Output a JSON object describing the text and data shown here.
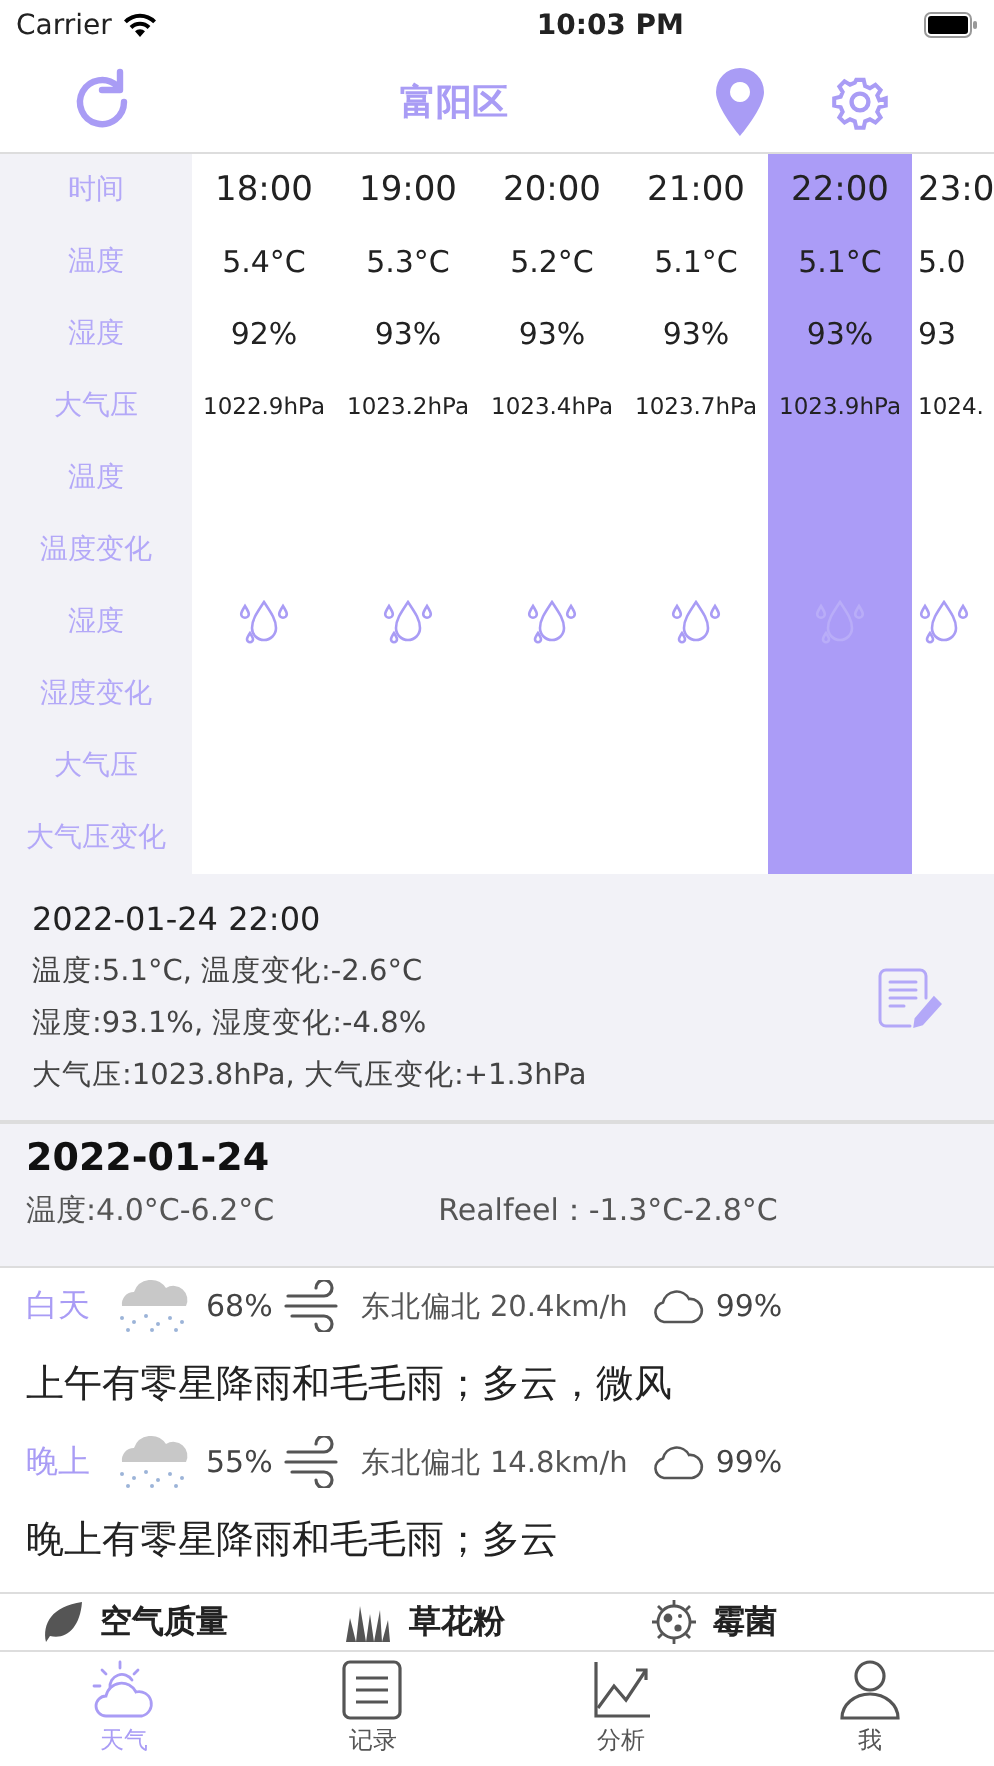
{
  "status_bar": {
    "carrier": "Carrier",
    "time": "10:03 PM"
  },
  "nav": {
    "title": "富阳区"
  },
  "table": {
    "rows": [
      {
        "label": "时间",
        "kind": "time"
      },
      {
        "label": "温度",
        "kind": "temperature"
      },
      {
        "label": "湿度",
        "kind": "humidity"
      },
      {
        "label": "大气压",
        "kind": "pressure"
      },
      {
        "label": "温度",
        "kind": "empty"
      },
      {
        "label": "温度变化",
        "kind": "empty"
      },
      {
        "label": "湿度",
        "kind": "drop"
      },
      {
        "label": "湿度变化",
        "kind": "empty"
      },
      {
        "label": "大气压",
        "kind": "empty"
      },
      {
        "label": "大气压变化",
        "kind": "empty"
      }
    ],
    "hours": [
      {
        "time": "18:00",
        "temperature": "5.4°C",
        "humidity": "92%",
        "pressure": "1022.9hPa",
        "selected": false
      },
      {
        "time": "19:00",
        "temperature": "5.3°C",
        "humidity": "93%",
        "pressure": "1023.2hPa",
        "selected": false
      },
      {
        "time": "20:00",
        "temperature": "5.2°C",
        "humidity": "93%",
        "pressure": "1023.4hPa",
        "selected": false
      },
      {
        "time": "21:00",
        "temperature": "5.1°C",
        "humidity": "93%",
        "pressure": "1023.7hPa",
        "selected": false
      },
      {
        "time": "22:00",
        "temperature": "5.1°C",
        "humidity": "93%",
        "pressure": "1023.9hPa",
        "selected": true
      },
      {
        "time": "23:0",
        "temperature": "5.0",
        "humidity": "93",
        "pressure": "1024.",
        "selected": false
      }
    ]
  },
  "detail": {
    "datetime": "2022-01-24 22:00",
    "lines": [
      "温度:5.1°C, 温度变化:-2.6°C",
      "湿度:93.1%, 湿度变化:-4.8%",
      "大气压:1023.8hPa, 大气压变化:+1.3hPa"
    ]
  },
  "day": {
    "date": "2022-01-24",
    "temperature": "温度:4.0°C-6.2°C",
    "realfeel": "Realfeel：-1.3°C-2.8°C"
  },
  "periods": [
    {
      "label": "白天",
      "precipitation": "68%",
      "wind": "东北偏北 20.4km/h",
      "cloud": "99%",
      "description": "上午有零星降雨和毛毛雨；多云，微风"
    },
    {
      "label": "晚上",
      "precipitation": "55%",
      "wind": "东北偏北 14.8km/h",
      "cloud": "99%",
      "description": "晚上有零星降雨和毛毛雨；多云"
    }
  ],
  "indices": [
    {
      "label": "空气质量",
      "kind": "leaf"
    },
    {
      "label": "草花粉",
      "kind": "grass"
    },
    {
      "label": "霉菌",
      "kind": "mold"
    }
  ],
  "tabs": [
    {
      "label": "天气",
      "kind": "weather",
      "selected": true
    },
    {
      "label": "记录",
      "kind": "record",
      "selected": false
    },
    {
      "label": "分析",
      "kind": "analysis",
      "selected": false
    },
    {
      "label": "我",
      "kind": "me",
      "selected": false
    }
  ]
}
